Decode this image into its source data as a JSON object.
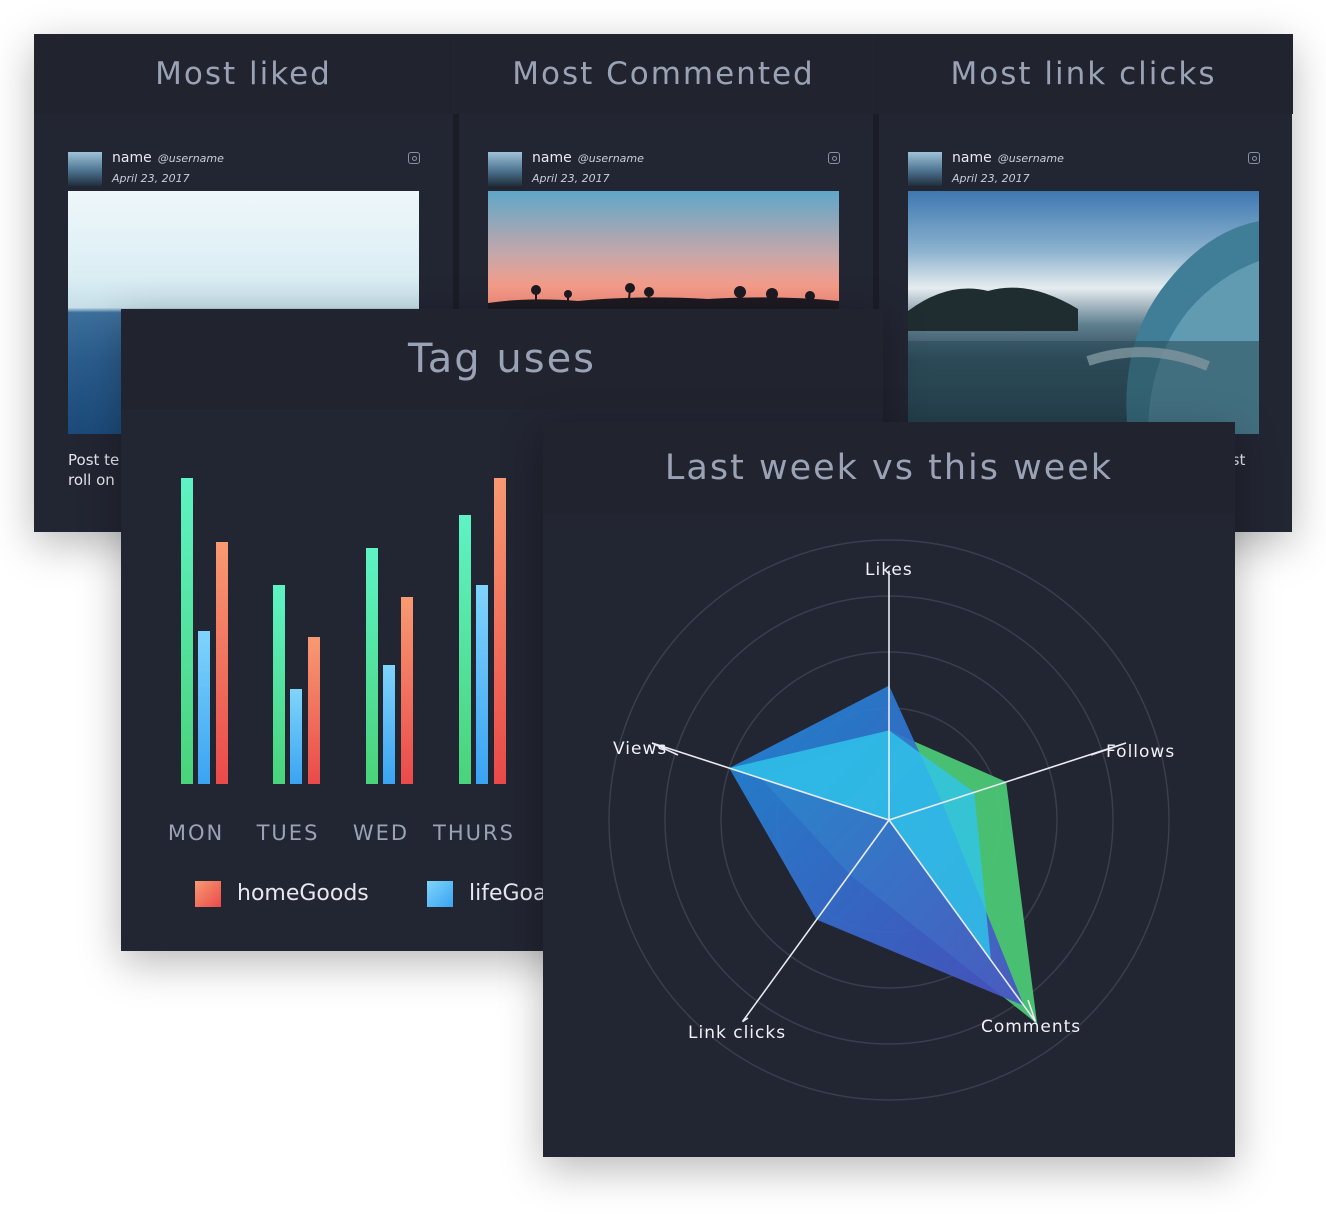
{
  "posts_panel": {
    "columns": [
      {
        "title": "Most liked",
        "card": {
          "name": "name",
          "username": "@username",
          "date": "April 23, 2017",
          "text_line1": "Post te",
          "text_line2": "roll on"
        }
      },
      {
        "title": "Most Commented",
        "card": {
          "name": "name",
          "username": "@username",
          "date": "April 23, 2017",
          "text_line1": "",
          "text_line2": ""
        }
      },
      {
        "title": "Most link clicks",
        "card": {
          "name": "name",
          "username": "@username",
          "date": "April 23, 2017",
          "text_line1": "just",
          "text_line2": ""
        }
      }
    ]
  },
  "tag_panel": {
    "title": "Tag uses",
    "legend": [
      {
        "label": "homeGoods",
        "color": "#f47a5c"
      },
      {
        "label": "lifeGoa",
        "color": "#5cc2f7"
      }
    ]
  },
  "radar_panel": {
    "title": "Last week vs this week"
  },
  "chart_data": [
    {
      "type": "bar",
      "categories": [
        "MON",
        "TUES",
        "WED",
        "THURS"
      ],
      "series": [
        {
          "name": "",
          "color": "#4ee3a0",
          "values": [
            100,
            65,
            77,
            88
          ]
        },
        {
          "name": "lifeGoa",
          "color": "#5cc2f7",
          "values": [
            50,
            31,
            39,
            65
          ]
        },
        {
          "name": "homeGoods",
          "color": "#f47a5c",
          "values": [
            79,
            48,
            61,
            100
          ]
        }
      ],
      "ylim": [
        0,
        100
      ]
    },
    {
      "type": "radar",
      "axes": [
        "Likes",
        "Follows",
        "Comments",
        "Link clicks",
        "Views"
      ],
      "rmax": 5,
      "series": [
        {
          "name": "",
          "color": "#4cc775",
          "values": [
            1.6,
            2.2,
            4.5,
            1.2,
            2.4
          ]
        },
        {
          "name": "",
          "color": "#3a8fe0",
          "values": [
            2.4,
            1.0,
            4.1,
            2.2,
            3.0
          ]
        },
        {
          "name": "",
          "color": "#2fc4ea",
          "values": [
            1.6,
            1.6,
            3.1,
            0.0,
            3.0
          ]
        }
      ]
    }
  ]
}
